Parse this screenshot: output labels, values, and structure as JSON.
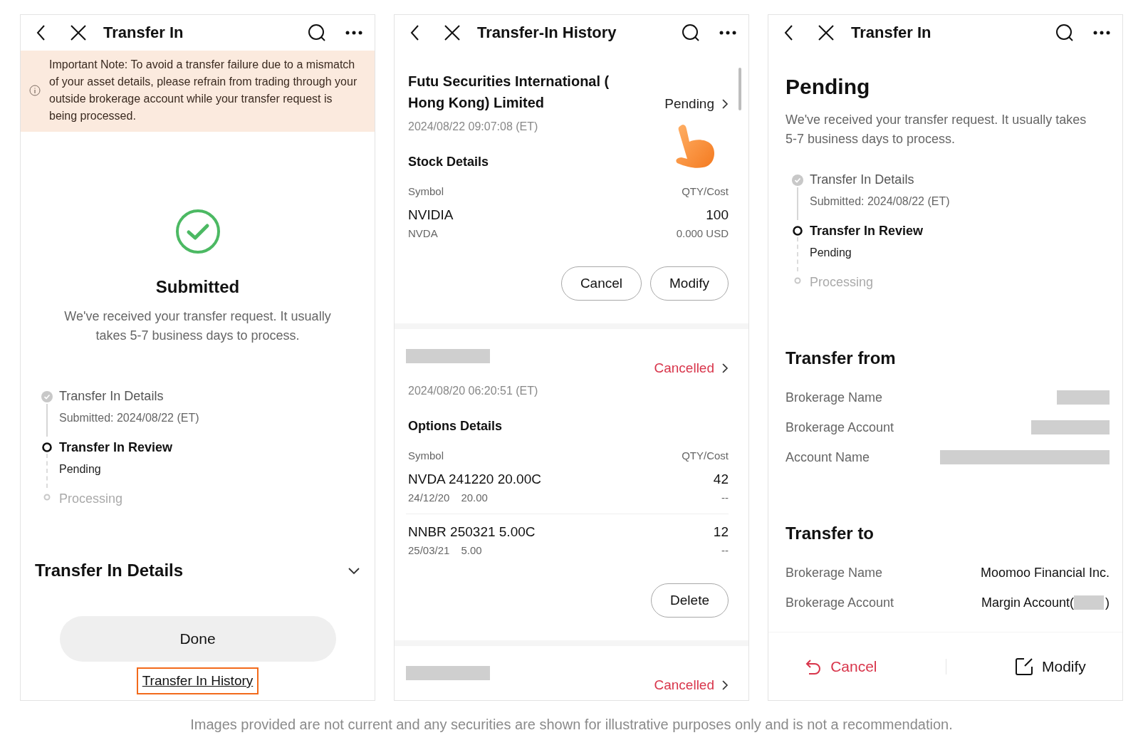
{
  "left_screen": {
    "header": {
      "title": "Transfer In"
    },
    "notice": "Important Note: To avoid a transfer failure due to a mismatch of your asset details, please refrain from trading through your outside brokerage account while your transfer request is being processed.",
    "status": {
      "title": "Submitted",
      "message": "We've received your transfer request. It usually takes 5-7 business days to process."
    },
    "steps": [
      {
        "label": "Transfer In Details",
        "detail": "Submitted: 2024/08/22 (ET)",
        "kind": "done"
      },
      {
        "label": "Transfer In Review",
        "detail": "Pending",
        "kind": "current"
      },
      {
        "label": "Processing",
        "kind": "upcoming"
      }
    ],
    "details_section": {
      "title": "Transfer In Details",
      "expanded": false
    },
    "done_button": "Done",
    "history_link": {
      "label": "Transfer In History",
      "highlighted": true
    }
  },
  "middle_screen": {
    "header": {
      "title": "Transfer-In History"
    },
    "records": [
      {
        "redacted": false,
        "broker": "Futu Securities International ( Hong Kong) Limited",
        "status": "Pending",
        "kind": "pending",
        "tapped": true,
        "time": "2024/08/22 09:07:08 (ET)",
        "section_title": "Stock Details",
        "columns": [
          "Symbol",
          "QTY/Cost"
        ],
        "rows": [
          {
            "name": "NVIDIA",
            "sub": [
              "NVDA"
            ],
            "qty": "100",
            "cost": "0.000 USD"
          }
        ],
        "actions": [
          "Cancel",
          "Modify"
        ]
      },
      {
        "redacted": true,
        "status": "Cancelled",
        "kind": "cancelled",
        "tapped": false,
        "time": "2024/08/20 06:20:51 (ET)",
        "section_title": "Options Details",
        "columns": [
          "Symbol",
          "QTY/Cost"
        ],
        "rows": [
          {
            "name": "NVDA 241220 20.00C",
            "sub": [
              "24/12/20",
              "20.00"
            ],
            "qty": "42",
            "cost": "--"
          },
          {
            "name": "NNBR 250321 5.00C",
            "sub": [
              "25/03/21",
              "5.00"
            ],
            "qty": "12",
            "cost": "--"
          }
        ],
        "actions": [
          "Delete"
        ]
      },
      {
        "redacted": true,
        "status": "Cancelled",
        "kind": "cancelled",
        "tapped": false
      }
    ]
  },
  "right_screen": {
    "header": {
      "title": "Transfer In"
    },
    "status": {
      "title": "Pending",
      "message": "We've received your transfer request. It usually takes 5-7 business days to process."
    },
    "steps": [
      {
        "label": "Transfer In Details",
        "detail": "Submitted: 2024/08/22 (ET)",
        "kind": "done"
      },
      {
        "label": "Transfer In Review",
        "detail": "Pending",
        "kind": "current"
      },
      {
        "label": "Processing",
        "kind": "upcoming"
      }
    ],
    "sections": [
      {
        "title": "Transfer from",
        "rows": [
          {
            "label": "Brokerage Name",
            "redacted": true
          },
          {
            "label": "Brokerage Account",
            "redacted": true
          },
          {
            "label": "Account Name",
            "redacted": true
          }
        ]
      },
      {
        "title": "Transfer to",
        "rows": [
          {
            "label": "Brokerage Name",
            "value": "Moomoo Financial Inc."
          },
          {
            "label": "Brokerage Account",
            "value": "Margin Account(",
            "redacted": true,
            "value_end": ")"
          }
        ]
      }
    ],
    "footer": [
      {
        "kind": "cancel",
        "label": "Cancel"
      },
      {
        "kind": "modify",
        "label": "Modify"
      }
    ]
  },
  "caption": "Images provided are not current and any securities are shown for illustrative purposes only and is not a recommendation."
}
